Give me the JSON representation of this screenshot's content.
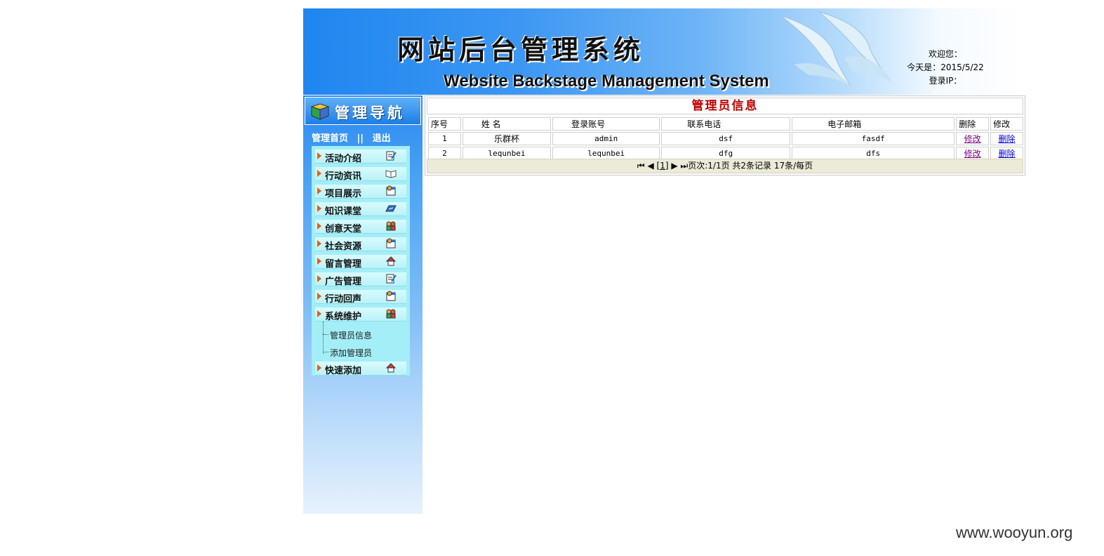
{
  "header": {
    "title_cn": "网站后台管理系统",
    "title_en": "Website Backstage Management System",
    "welcome": "欢迎您：",
    "today_label": "今天是：2015/5/22",
    "login_ip": "登录IP："
  },
  "sidebar": {
    "nav_title": "管理导航",
    "home_link": "管理首页",
    "separator": "||",
    "logout_link": "退出",
    "menu": [
      {
        "label": "活动介绍",
        "icon": "edit-icon"
      },
      {
        "label": "行动资讯",
        "icon": "book-icon"
      },
      {
        "label": "项目展示",
        "icon": "window-user-icon"
      },
      {
        "label": "知识课堂",
        "icon": "card-icon"
      },
      {
        "label": "创意天堂",
        "icon": "users-icon"
      },
      {
        "label": "社会资源",
        "icon": "window-user-icon"
      },
      {
        "label": "留言管理",
        "icon": "home-icon"
      },
      {
        "label": "广告管理",
        "icon": "edit-icon"
      },
      {
        "label": "行动回声",
        "icon": "window-user-icon"
      },
      {
        "label": "系统维护",
        "icon": "users-icon"
      },
      {
        "label": "快速添加",
        "icon": "home-icon"
      }
    ],
    "submenu": [
      "管理员信息",
      "添加管理员"
    ]
  },
  "panel": {
    "title": "管理员信息",
    "columns": [
      "序号",
      "姓 名",
      "登录账号",
      "联系电话",
      "电子邮箱",
      "删除",
      "修改"
    ],
    "rows": [
      {
        "no": "1",
        "name": "乐群杯",
        "account": "admin",
        "phone": "dsf",
        "email": "fasdf",
        "action1": "修改",
        "action2": "删除"
      },
      {
        "no": "2",
        "name": "lequnbei",
        "account": "lequnbei",
        "phone": "dfg",
        "email": "dfs",
        "action1": "修改",
        "action2": "删除"
      }
    ],
    "pager": {
      "page_number": "[1]",
      "summary": "页次:1/1页 共2条记录 17条/每页"
    }
  },
  "watermark": "www.wooyun.org",
  "colors": {
    "banner_blue": "#1f86ef",
    "title_red": "#c00000",
    "menu_bg": "#a3eef7",
    "arrow_orange": "#f05a0a"
  }
}
